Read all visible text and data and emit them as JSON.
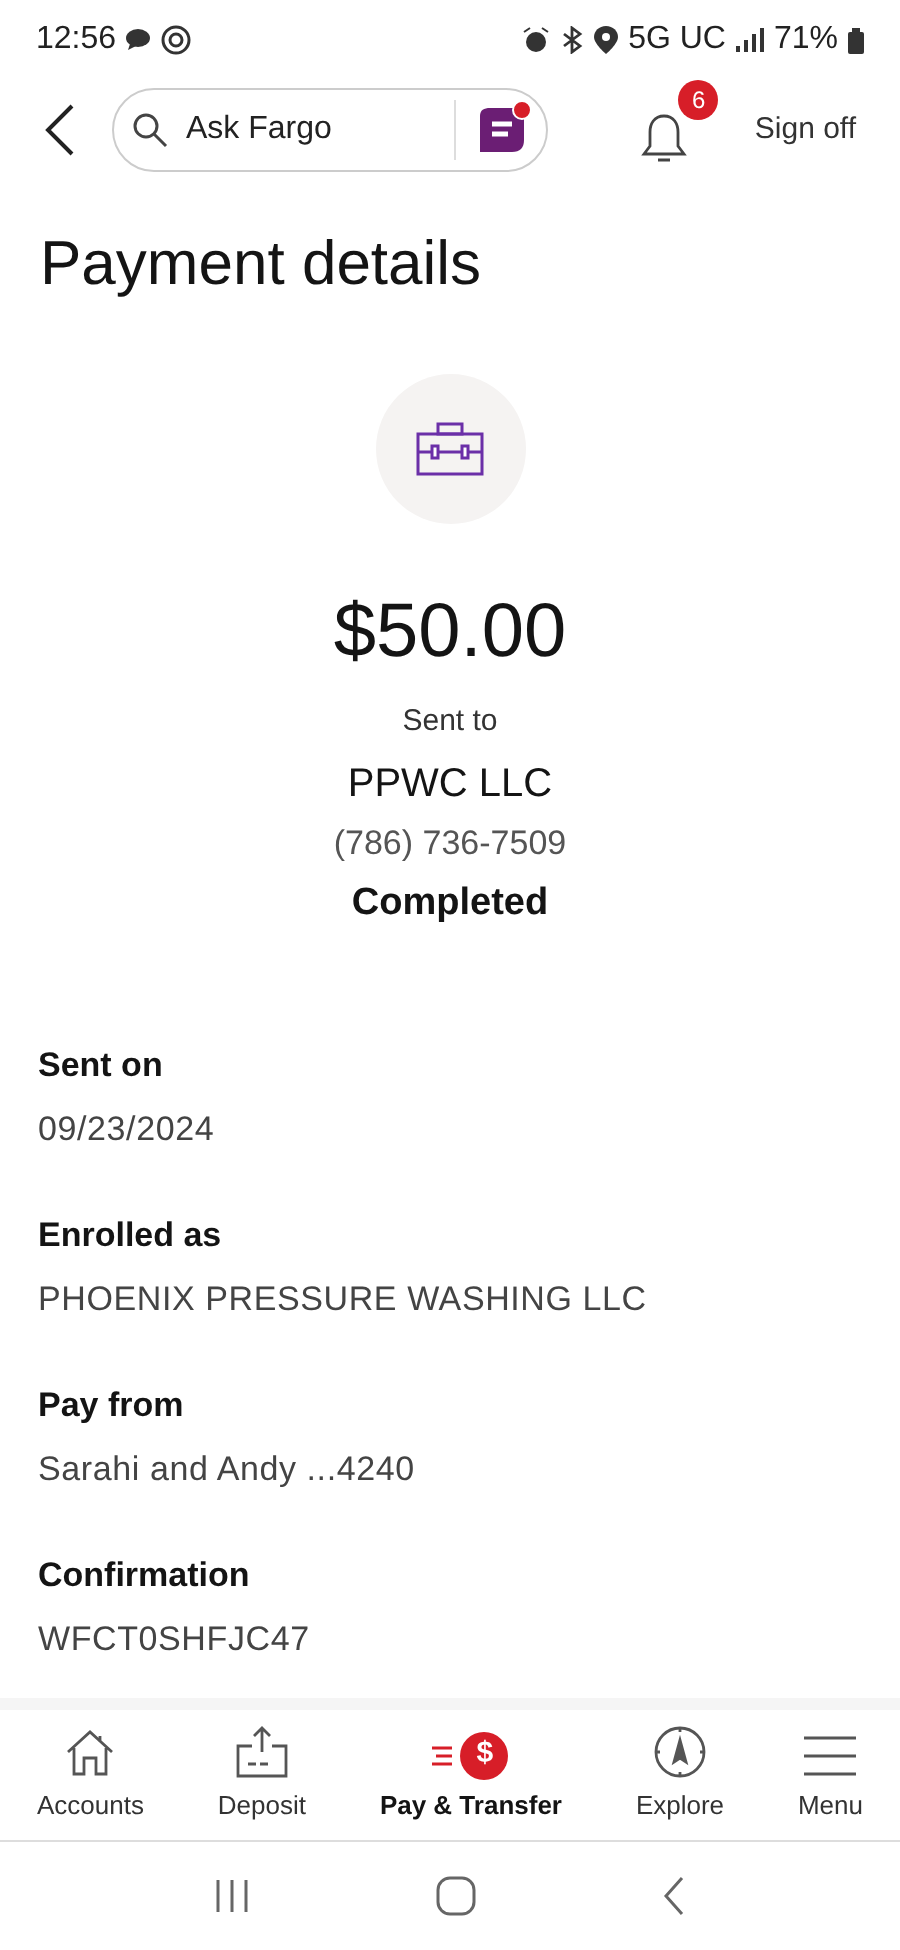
{
  "status_bar": {
    "time": "12:56",
    "network": "5G UC",
    "battery": "71%"
  },
  "header": {
    "search": {
      "placeholder": "Ask Fargo"
    },
    "notifications": {
      "count": "6"
    },
    "sign_off": "Sign off"
  },
  "title": "Payment details",
  "payment": {
    "amount": "$50.00",
    "sent_to_label": "Sent to",
    "payee": "PPWC LLC",
    "phone": "(786) 736-7509",
    "status": "Completed"
  },
  "details": [
    {
      "label": "Sent on",
      "value": "09/23/2024"
    },
    {
      "label": "Enrolled as",
      "value": "PHOENIX PRESSURE WASHING LLC"
    },
    {
      "label": "Pay from",
      "value": "Sarahi and Andy ...4240"
    },
    {
      "label": "Confirmation",
      "value": "WFCT0SHFJC47"
    }
  ],
  "bottom_nav": [
    {
      "kind": "home",
      "label": "Accounts",
      "selected": false
    },
    {
      "kind": "deposit",
      "label": "Deposit",
      "selected": false
    },
    {
      "kind": "pay",
      "label": "Pay & Transfer",
      "selected": true,
      "icon_text": "$"
    },
    {
      "kind": "compass",
      "label": "Explore",
      "selected": false
    },
    {
      "kind": "menu",
      "label": "Menu",
      "selected": false
    }
  ]
}
